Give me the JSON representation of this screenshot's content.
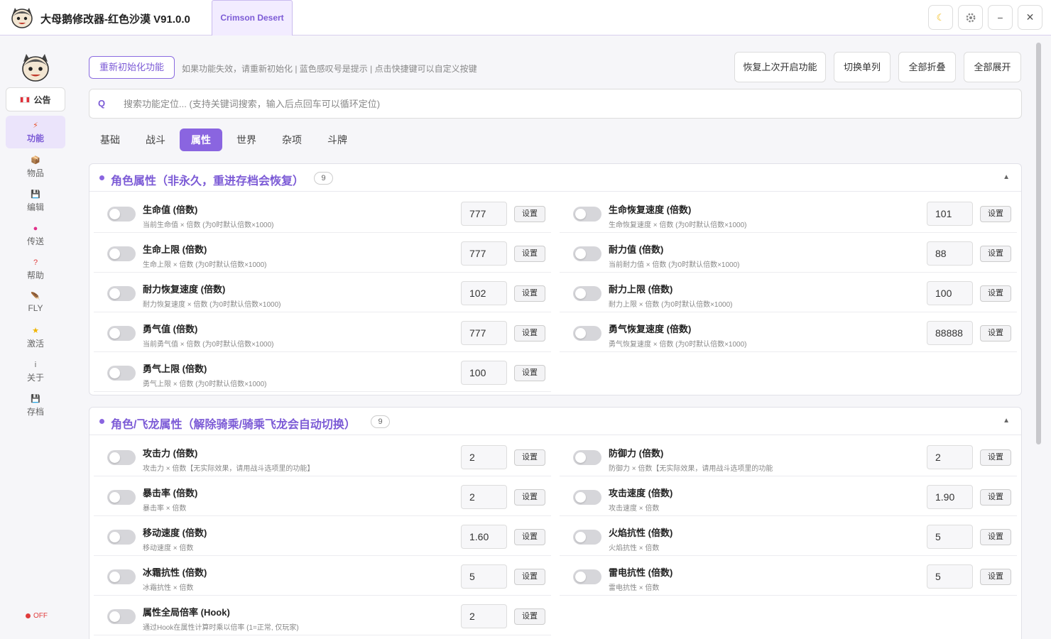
{
  "window": {
    "title": "大母鹅修改器-红色沙漠  V91.0.0",
    "game_tab": "Crimson Desert",
    "controls": {
      "theme": "moon-icon",
      "settings": "gear-icon",
      "minimize": "−",
      "close": "✕"
    }
  },
  "sidebar": {
    "notice_label": "公告",
    "items": [
      {
        "label": "功能",
        "icon": "⚡",
        "color": "#e8542b",
        "active": true
      },
      {
        "label": "物品",
        "icon": "📦",
        "color": "#c8912f",
        "active": false
      },
      {
        "label": "编辑",
        "icon": "💾",
        "color": "#555555",
        "active": false
      },
      {
        "label": "传送",
        "icon": "●",
        "color": "#e0308a",
        "active": false
      },
      {
        "label": "帮助",
        "icon": "?",
        "color": "#e03c3c",
        "active": false
      },
      {
        "label": "FLY",
        "icon": "🪶",
        "color": "#777777",
        "active": false
      },
      {
        "label": "激活",
        "icon": "★",
        "color": "#f0b400",
        "active": false
      },
      {
        "label": "关于",
        "icon": "i",
        "color": "#666666",
        "active": false
      },
      {
        "label": "存档",
        "icon": "💾",
        "color": "#555555",
        "active": false
      }
    ],
    "status": "OFF"
  },
  "toolbar": {
    "reinit_label": "重新初始化功能",
    "hint": "如果功能失效，请重新初始化 | 蓝色感叹号是提示 | 点击快捷键可以自定义按键",
    "buttons": [
      "恢复上次开启功能",
      "切换单列",
      "全部折叠",
      "全部展开"
    ]
  },
  "search": {
    "icon": "Q",
    "placeholder": "搜索功能定位... (支持关键词搜索，输入后点回车可以循环定位)"
  },
  "tabs": [
    {
      "label": "基础",
      "active": false
    },
    {
      "label": "战斗",
      "active": false
    },
    {
      "label": "属性",
      "active": true
    },
    {
      "label": "世界",
      "active": false
    },
    {
      "label": "杂项",
      "active": false
    },
    {
      "label": "斗牌",
      "active": false
    }
  ],
  "set_label": "设置",
  "sections": [
    {
      "title": "角色属性（非永久，重进存档会恢复）",
      "count": "9",
      "collapse_icon": "▲",
      "rows": [
        {
          "title": "生命值 (倍数)",
          "desc": "当前生命值 × 倍数 (为0时默认倍数×1000)",
          "value": "777"
        },
        {
          "title": "生命恢复速度 (倍数)",
          "desc": "生命恢复速度 × 倍数 (为0时默认倍数×1000)",
          "value": "101"
        },
        {
          "title": "生命上限 (倍数)",
          "desc": "生命上限 × 倍数 (为0时默认倍数×1000)",
          "value": "777"
        },
        {
          "title": "耐力值 (倍数)",
          "desc": "当前耐力值 × 倍数 (为0时默认倍数×1000)",
          "value": "88"
        },
        {
          "title": "耐力恢复速度 (倍数)",
          "desc": "耐力恢复速度 × 倍数 (为0时默认倍数×1000)",
          "value": "102"
        },
        {
          "title": "耐力上限 (倍数)",
          "desc": "耐力上限 × 倍数 (为0时默认倍数×1000)",
          "value": "100"
        },
        {
          "title": "勇气值 (倍数)",
          "desc": "当前勇气值 × 倍数 (为0时默认倍数×1000)",
          "value": "777"
        },
        {
          "title": "勇气恢复速度 (倍数)",
          "desc": "勇气恢复速度 × 倍数 (为0时默认倍数×1000)",
          "value": "88888"
        },
        {
          "title": "勇气上限 (倍数)",
          "desc": "勇气上限 × 倍数 (为0时默认倍数×1000)",
          "value": "100"
        }
      ]
    },
    {
      "title": "角色/飞龙属性（解除骑乘/骑乘飞龙会自动切换）",
      "count": "9",
      "collapse_icon": "▲",
      "rows": [
        {
          "title": "攻击力 (倍数)",
          "desc": "攻击力 × 倍数【无实际效果，请用战斗选项里的功能】",
          "value": "2"
        },
        {
          "title": "防御力 (倍数)",
          "desc": "防御力 × 倍数【无实际效果，请用战斗选项里的功能",
          "value": "2"
        },
        {
          "title": "暴击率 (倍数)",
          "desc": "暴击率 × 倍数",
          "value": "2"
        },
        {
          "title": "攻击速度 (倍数)",
          "desc": "攻击速度 × 倍数",
          "value": "1.90"
        },
        {
          "title": "移动速度 (倍数)",
          "desc": "移动速度 × 倍数",
          "value": "1.60"
        },
        {
          "title": "火焰抗性 (倍数)",
          "desc": "火焰抗性 × 倍数",
          "value": "5"
        },
        {
          "title": "冰霜抗性 (倍数)",
          "desc": "冰霜抗性 × 倍数",
          "value": "5"
        },
        {
          "title": "雷电抗性 (倍数)",
          "desc": "雷电抗性 × 倍数",
          "value": "5"
        },
        {
          "title": "属性全局倍率 (Hook)",
          "desc": "通过Hook在属性计算时乘以倍率 (1=正常, 仅玩家)",
          "value": "2"
        }
      ]
    }
  ]
}
